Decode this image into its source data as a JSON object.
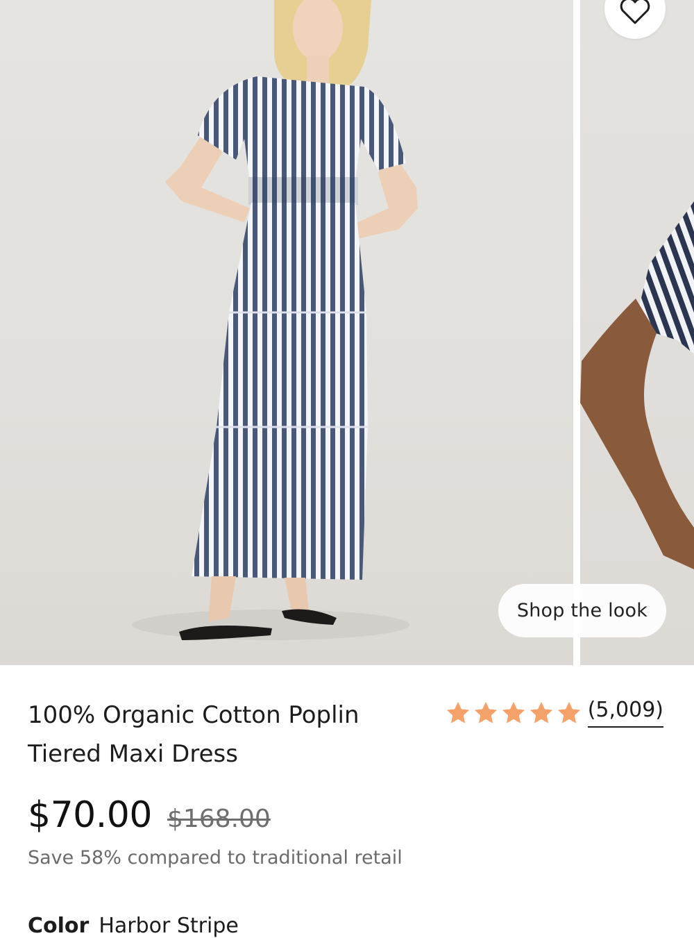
{
  "gallery": {
    "shop_look_label": "Shop the look",
    "favorite_icon": "heart-icon"
  },
  "product": {
    "title_line1": "100% Organic Cotton Poplin",
    "title_line2": "Tiered Maxi Dress",
    "price": "$70.00",
    "original_price": "$168.00",
    "savings_text": "Save 58% compared to traditional retail",
    "color_label": "Color",
    "color_value": "Harbor Stripe"
  },
  "rating": {
    "stars": 5,
    "max_stars": 5,
    "count_text": "(5,009)",
    "star_color": "#f4a26c"
  }
}
